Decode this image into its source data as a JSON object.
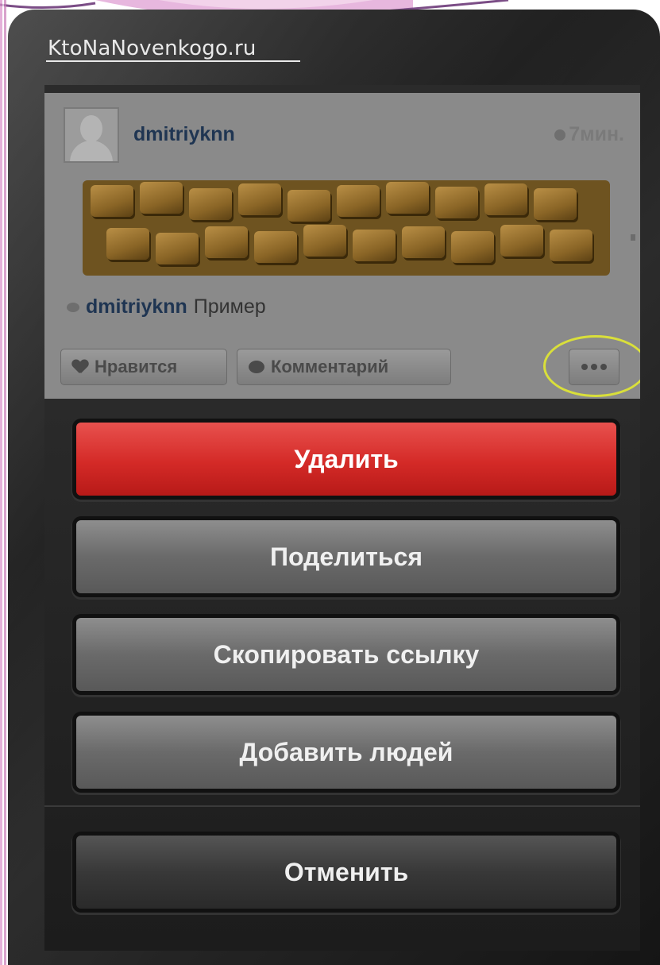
{
  "watermark": "KtoNaNovenkogo.ru",
  "post": {
    "username": "dmitriyknn",
    "time": "7мин.",
    "caption_user": "dmitriyknn",
    "caption_text": "Пример",
    "like_label": "Нравится",
    "comment_label": "Комментарий"
  },
  "sheet": {
    "delete_label": "Удалить",
    "share_label": "Поделиться",
    "copy_link_label": "Скопировать ссылку",
    "add_people_label": "Добавить людей",
    "cancel_label": "Отменить"
  },
  "colors": {
    "delete": "#d42a27",
    "highlight": "#d9df3a",
    "username": "#1f3552"
  }
}
